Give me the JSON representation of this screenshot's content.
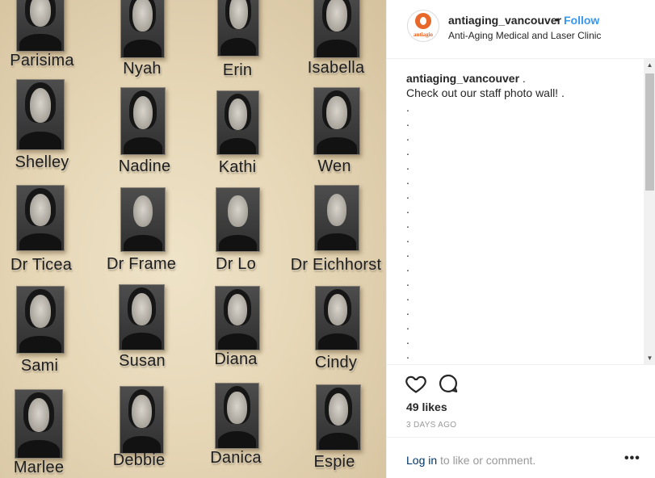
{
  "photo_wall": {
    "names": [
      "Parisima",
      "Nyah",
      "Erin",
      "Isabella",
      "Shelley",
      "Nadine",
      "Kathi",
      "Wen",
      "Dr Ticea",
      "Dr Frame",
      "Dr Lo",
      "Dr Eichhorst",
      "Sami",
      "Susan",
      "Diana",
      "Cindy",
      "Marlee",
      "Debbie",
      "Danica",
      "Espie"
    ]
  },
  "post": {
    "username": "antiaging_vancouver",
    "separator": "•",
    "follow_label": "Follow",
    "location": "Anti-Aging Medical and Laser Clinic",
    "avatar_text": "antiagio",
    "caption_user": "antiaging_vancouver",
    "caption_after_user": " .",
    "caption_text": "Check out our staff photo wall! .",
    "dots": [
      ".",
      ".",
      ".",
      ".",
      ".",
      ".",
      ".",
      ".",
      ".",
      ".",
      ".",
      ".",
      ".",
      ".",
      ".",
      ".",
      ".",
      "."
    ],
    "likes": "49 likes",
    "time": "3 DAYS AGO",
    "login_link": "Log in",
    "login_rest": "to like or comment.",
    "more": "•••"
  },
  "icons": [
    "heart-icon",
    "comment-icon",
    "more-icon",
    "scroll-up-icon",
    "scroll-down-icon"
  ],
  "colors": {
    "link": "#3897f0",
    "text": "#262626",
    "muted": "#999999",
    "brand": "#e8672a"
  }
}
